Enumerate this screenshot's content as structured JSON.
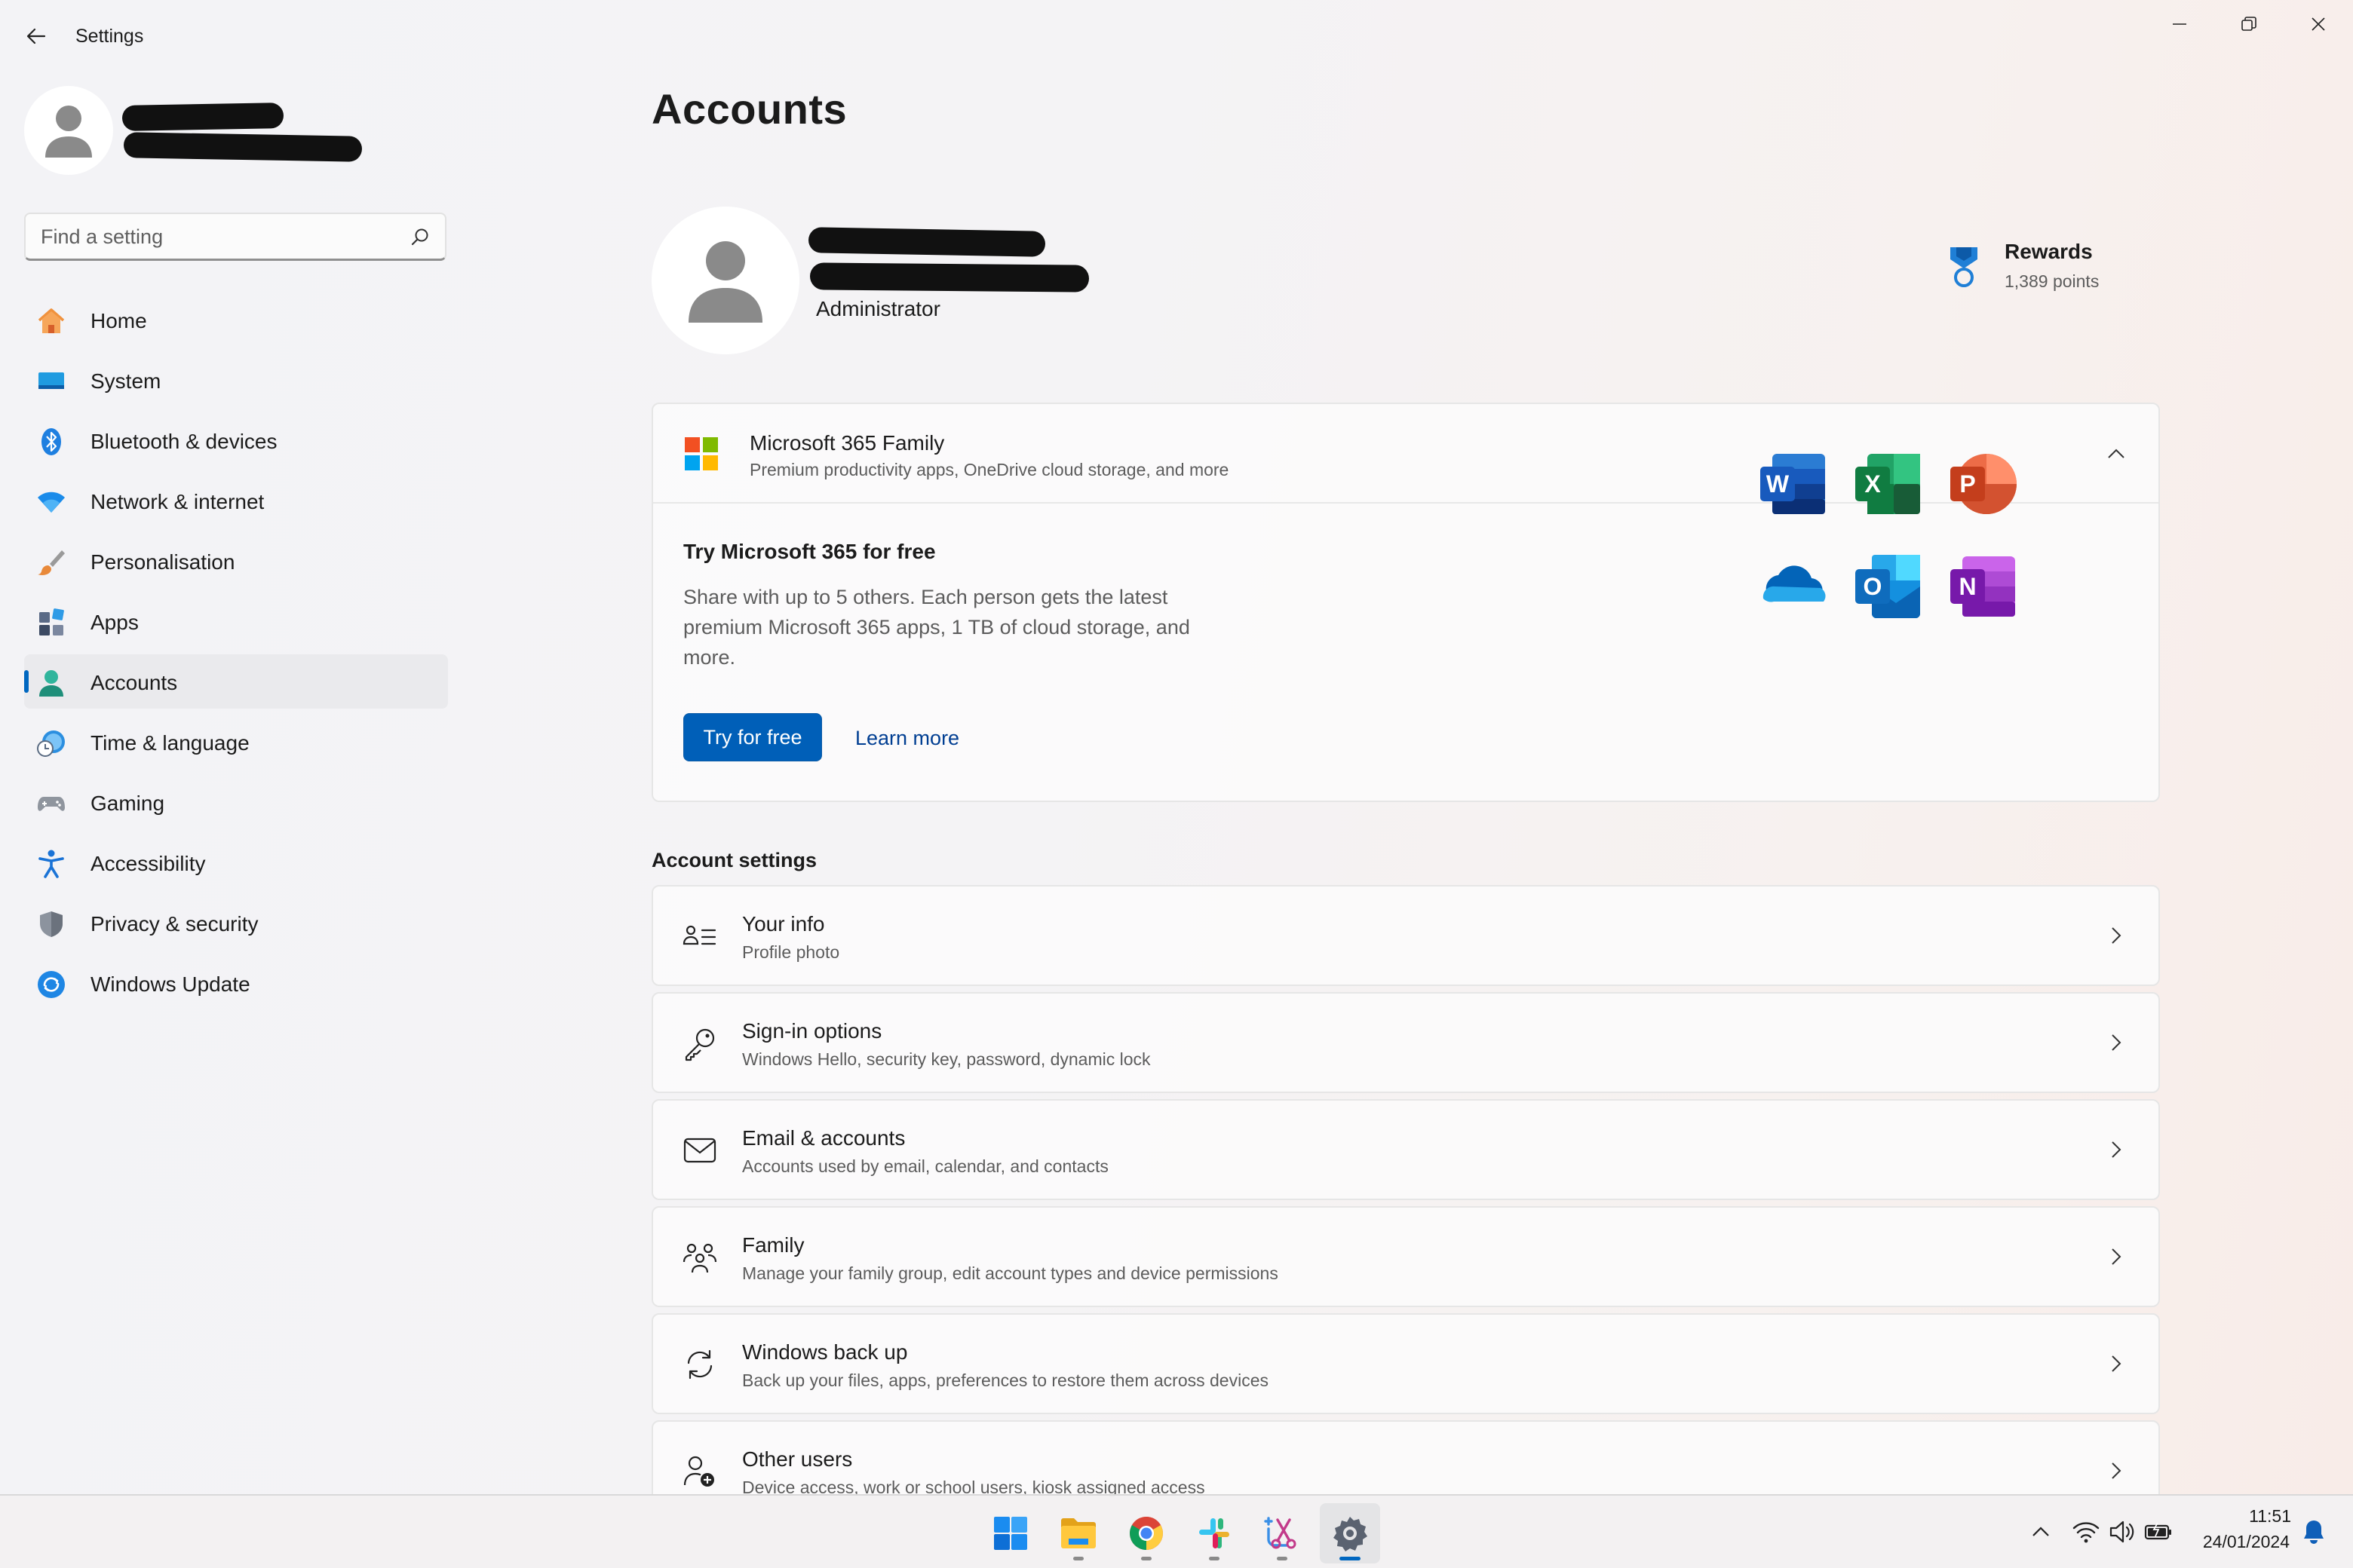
{
  "window": {
    "title": "Settings"
  },
  "sidebar": {
    "search": {
      "placeholder": "Find a setting",
      "value": ""
    },
    "items": [
      {
        "label": "Home",
        "icon": "home-icon"
      },
      {
        "label": "System",
        "icon": "system-icon"
      },
      {
        "label": "Bluetooth & devices",
        "icon": "bluetooth-icon"
      },
      {
        "label": "Network & internet",
        "icon": "wifi-icon"
      },
      {
        "label": "Personalisation",
        "icon": "brush-icon"
      },
      {
        "label": "Apps",
        "icon": "apps-icon"
      },
      {
        "label": "Accounts",
        "icon": "accounts-icon",
        "selected": true
      },
      {
        "label": "Time & language",
        "icon": "clock-globe-icon"
      },
      {
        "label": "Gaming",
        "icon": "gamepad-icon"
      },
      {
        "label": "Accessibility",
        "icon": "accessibility-icon"
      },
      {
        "label": "Privacy & security",
        "icon": "shield-icon"
      },
      {
        "label": "Windows Update",
        "icon": "update-icon"
      }
    ]
  },
  "main": {
    "title": "Accounts",
    "account": {
      "role": "Administrator"
    },
    "rewards": {
      "title": "Rewards",
      "points": "1,389 points"
    },
    "m365": {
      "title": "Microsoft 365 Family",
      "subtitle": "Premium productivity apps, OneDrive cloud storage, and more",
      "offer_title": "Try Microsoft 365 for free",
      "offer_desc": "Share with up to 5 others. Each person gets the latest premium Microsoft 365 apps, 1 TB of cloud storage, and more.",
      "try_label": "Try for free",
      "learn_label": "Learn more",
      "apps": [
        {
          "letter": "W",
          "icon": "word-icon"
        },
        {
          "letter": "X",
          "icon": "excel-icon"
        },
        {
          "letter": "P",
          "icon": "powerpoint-icon"
        },
        {
          "letter": "",
          "icon": "onedrive-icon"
        },
        {
          "letter": "O",
          "icon": "outlook-icon"
        },
        {
          "letter": "N",
          "icon": "onenote-icon"
        }
      ]
    },
    "settings_heading": "Account settings",
    "rows": [
      {
        "title": "Your info",
        "subtitle": "Profile photo",
        "icon": "person-card-icon"
      },
      {
        "title": "Sign-in options",
        "subtitle": "Windows Hello, security key, password, dynamic lock",
        "icon": "key-icon"
      },
      {
        "title": "Email & accounts",
        "subtitle": "Accounts used by email, calendar, and contacts",
        "icon": "mail-icon"
      },
      {
        "title": "Family",
        "subtitle": "Manage your family group, edit account types and device permissions",
        "icon": "family-icon"
      },
      {
        "title": "Windows back up",
        "subtitle": "Back up your files, apps, preferences to restore them across devices",
        "icon": "sync-icon"
      },
      {
        "title": "Other users",
        "subtitle": "Device access, work or school users, kiosk assigned access",
        "icon": "add-user-icon"
      }
    ]
  },
  "taskbar": {
    "apps": [
      "start-icon",
      "file-explorer-icon",
      "chrome-icon",
      "slack-icon",
      "snipping-tool-icon",
      "settings-icon"
    ],
    "time": "11:51",
    "date": "24/01/2024"
  },
  "colors": {
    "accent": "#005fb8",
    "link": "#003e92"
  }
}
